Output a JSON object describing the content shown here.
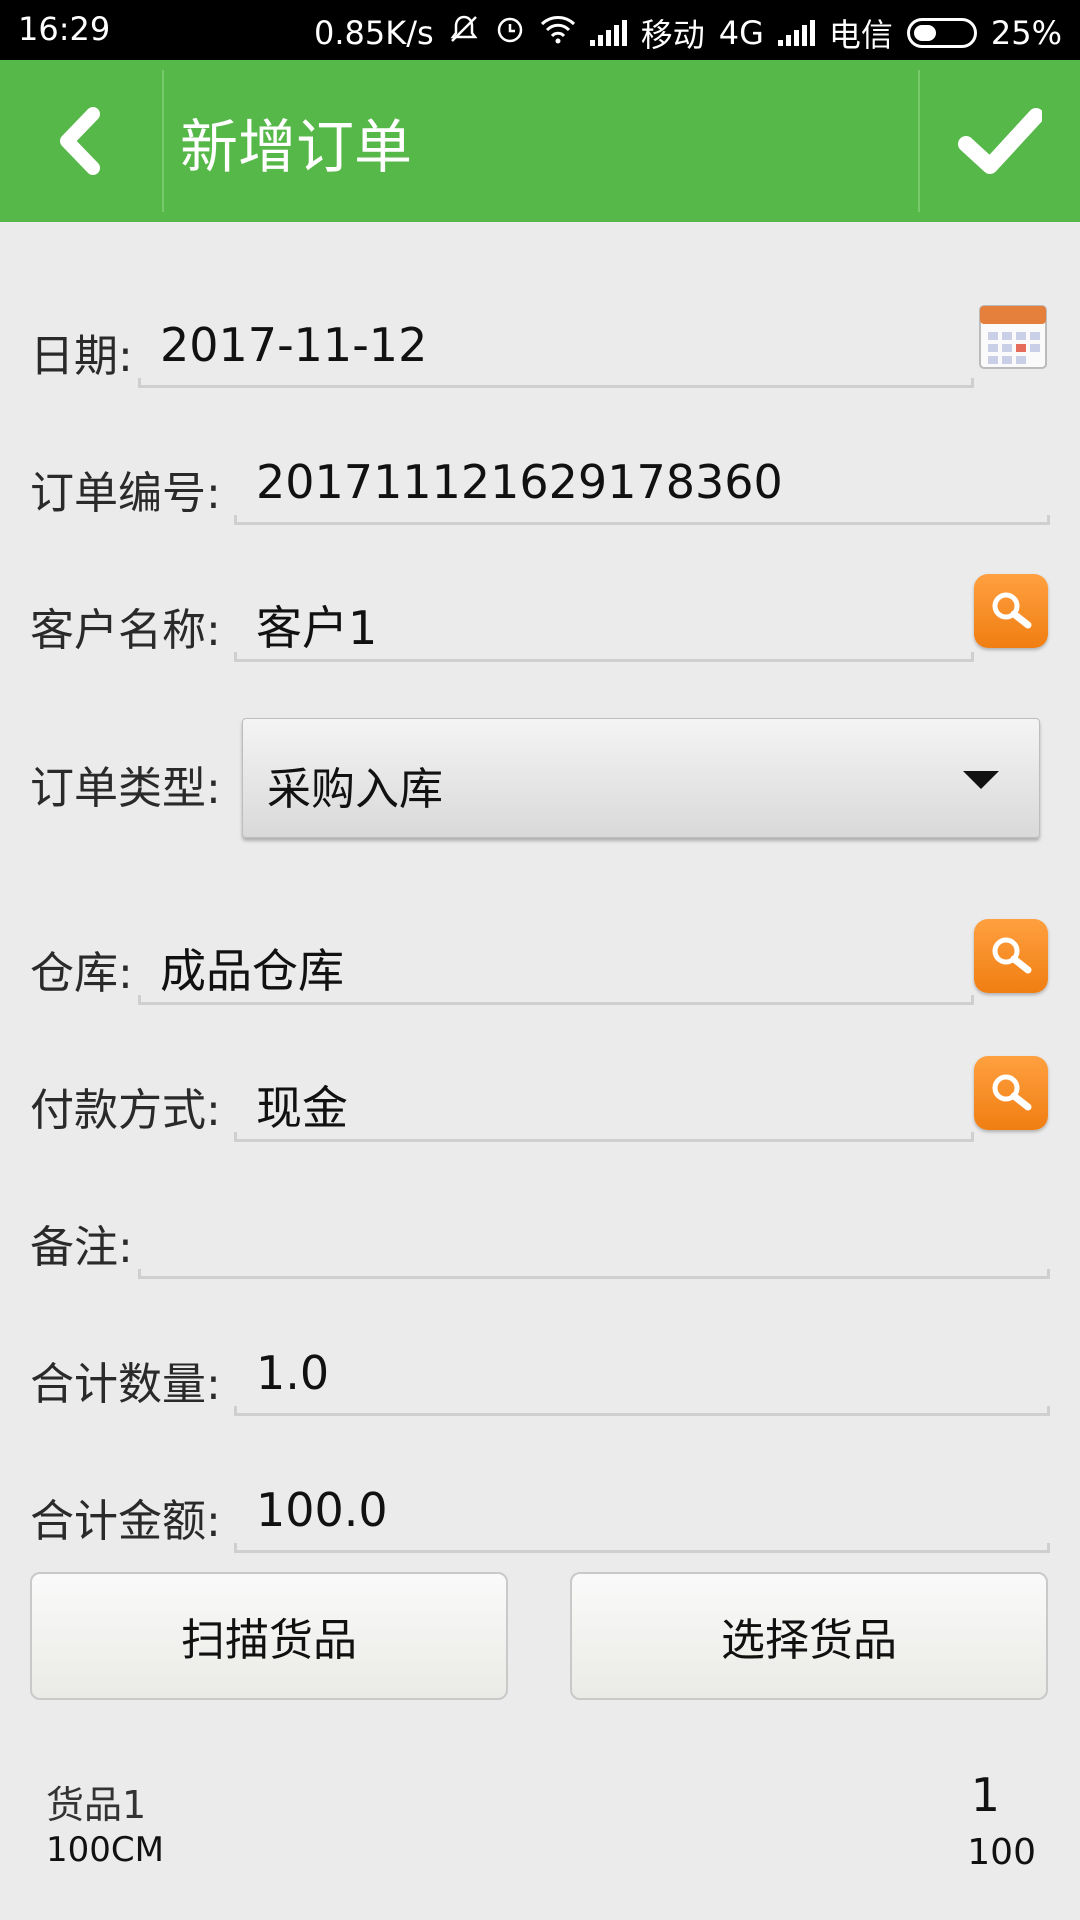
{
  "status_bar": {
    "time": "16:29",
    "speed": "0.85K/s",
    "carrier1": "移动",
    "network": "4G",
    "carrier2": "电信",
    "battery": "25%"
  },
  "header": {
    "title": "新增订单",
    "back_icon": "chevron-left-icon",
    "confirm_icon": "checkmark-icon",
    "color": "#57b84a"
  },
  "form": {
    "date_label": "日期:",
    "date_value": "2017-11-12",
    "order_no_label": "订单编号:",
    "order_no_value": "201711121629178360",
    "customer_label": "客户名称:",
    "customer_value": "客户1",
    "order_type_label": "订单类型:",
    "order_type_value": "采购入库",
    "warehouse_label": "仓库:",
    "warehouse_value": "成品仓库",
    "payment_label": "付款方式:",
    "payment_value": "现金",
    "remark_label": "备注:",
    "remark_value": "",
    "total_qty_label": "合计数量:",
    "total_qty_value": "1.0",
    "total_amount_label": "合计金额:",
    "total_amount_value": "100.0"
  },
  "actions": {
    "scan_label": "扫描货品",
    "select_label": "选择货品"
  },
  "goods": [
    {
      "name": "货品1",
      "spec": "100CM",
      "qty": "1",
      "price": "100"
    }
  ]
}
